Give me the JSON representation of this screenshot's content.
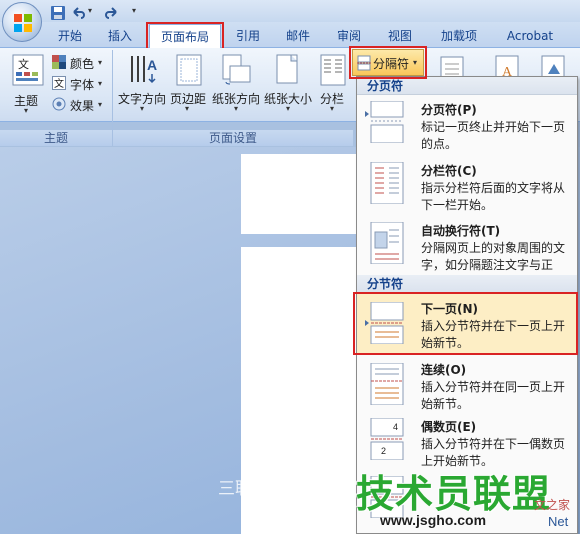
{
  "quick_access": {
    "save_icon": "save-icon",
    "undo_icon": "undo-icon",
    "redo_icon": "redo-icon",
    "customize": "▾"
  },
  "tabs": [
    "开始",
    "插入",
    "页面布局",
    "引用",
    "邮件",
    "审阅",
    "视图",
    "加载项",
    "Acrobat"
  ],
  "active_tab": "页面布局",
  "ribbon": {
    "theme_group": {
      "caption": "主题",
      "themes_label": "主题",
      "colors_label": "颜色",
      "fonts_label": "字体",
      "effects_label": "效果"
    },
    "page_setup_group": {
      "caption": "页面设置",
      "text_direction": "文字方向",
      "margins": "页边距",
      "orientation": "纸张方向",
      "size": "纸张大小",
      "columns": "分栏",
      "breaks_button": "分隔符"
    }
  },
  "breaks_menu": {
    "page_breaks_header": "分页符",
    "section_breaks_header": "分节符",
    "items": [
      {
        "title": "分页符(P)",
        "desc": "标记一页终止并开始下一页的点。"
      },
      {
        "title": "分栏符(C)",
        "desc": "指示分栏符后面的文字将从下一栏开始。"
      },
      {
        "title": "自动换行符(T)",
        "desc": "分隔网页上的对象周围的文字，如分隔题注文字与正文。"
      },
      {
        "title": "下一页(N)",
        "desc": "插入分节符并在下一页上开始新节。"
      },
      {
        "title": "连续(O)",
        "desc": "插入分节符并在同一页上开始新节。"
      },
      {
        "title": "偶数页(E)",
        "desc": "插入分节符并在下一偶数页上开始新节。"
      }
    ],
    "page_number_glyph": "2",
    "page_number_glyph_2": "4"
  },
  "watermarks": {
    "sanlian": "三联网 3LIAN",
    "jishu": "技术员联盟",
    "site": "www.jsgho.com",
    "net": "Net",
    "wenzhijia": "文之家"
  },
  "colors": {
    "highlight_red": "#d92323",
    "ribbon_blue": "#15428b",
    "watermark_green": "#2aa832"
  }
}
